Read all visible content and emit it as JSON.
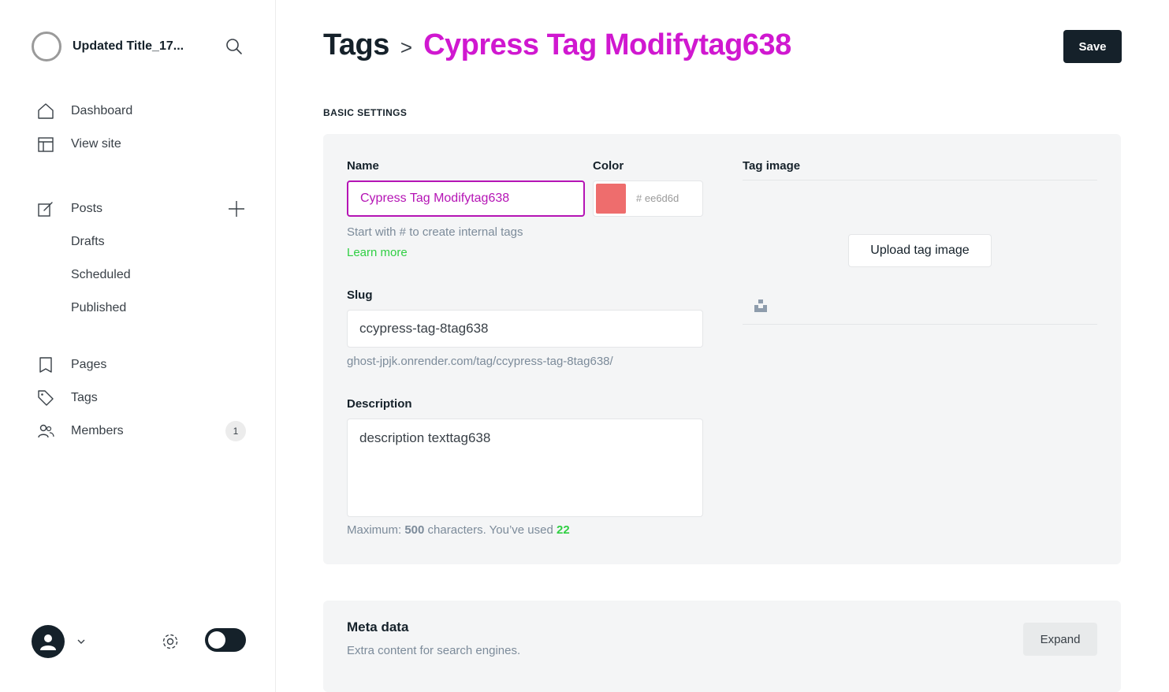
{
  "sidebar": {
    "site_title": "Updated Title_17...",
    "nav": [
      {
        "label": "Dashboard"
      },
      {
        "label": "View site"
      }
    ],
    "posts": {
      "label": "Posts",
      "sub": [
        {
          "label": "Drafts"
        },
        {
          "label": "Scheduled"
        },
        {
          "label": "Published"
        }
      ]
    },
    "nav2": [
      {
        "label": "Pages"
      },
      {
        "label": "Tags"
      },
      {
        "label": "Members",
        "badge": "1"
      }
    ]
  },
  "header": {
    "breadcrumb": "Tags",
    "separator": ">",
    "tag_title": "Cypress Tag Modifytag638",
    "save_label": "Save"
  },
  "basic": {
    "section_label": "BASIC SETTINGS",
    "name_label": "Name",
    "name_value": "Cypress Tag Modifytag638",
    "name_hint": "Start with # to create internal tags",
    "learn_more": "Learn more",
    "color_label": "Color",
    "color_value": "ee6d6d",
    "color_hex": "#ee6d6d",
    "color_hash": "#",
    "image_label": "Tag image",
    "upload_label": "Upload tag image",
    "slug_label": "Slug",
    "slug_value": "ccypress-tag-8tag638",
    "slug_url": "ghost-jpjk.onrender.com/tag/ccypress-tag-8tag638/",
    "desc_label": "Description",
    "desc_value": "description texttag638",
    "desc_hint_prefix": "Maximum: ",
    "desc_max": "500",
    "desc_hint_mid": " characters. You’ve used ",
    "desc_used": "22"
  },
  "meta": {
    "title": "Meta data",
    "subtitle": "Extra content for search engines.",
    "expand_label": "Expand"
  },
  "colors": {
    "accent_green": "#30cf43",
    "tag_title_magenta": "#d018d0",
    "focus_border": "#b514b5"
  }
}
